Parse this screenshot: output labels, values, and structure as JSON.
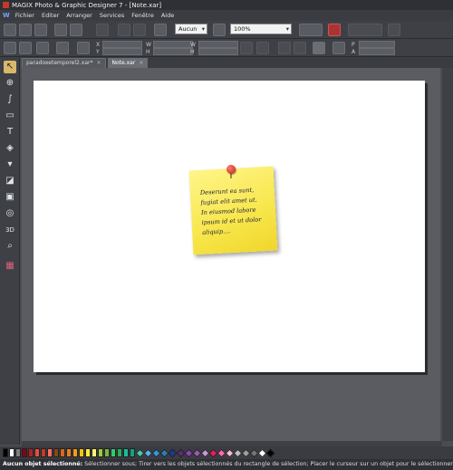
{
  "window": {
    "title": "MAGIX Photo & Graphic Designer 7 - [Note.xar]"
  },
  "menu": {
    "items": [
      "Fichier",
      "Editer",
      "Arranger",
      "Services",
      "Fenêtre",
      "Aide"
    ]
  },
  "toolbar": {
    "zoom_mode": "Aucun",
    "zoom_percent": "100%",
    "x_label": "X",
    "y_label": "Y",
    "w_label": "W",
    "h_label": "H",
    "p_label": "P",
    "a_label": "A"
  },
  "tabs": [
    {
      "label": "paradoxetemporel2.xar*",
      "active": false
    },
    {
      "label": "Note.xar",
      "active": true
    }
  ],
  "note": {
    "lines": [
      "Deserunt ea sunt,",
      "fugiat elit amet ut.",
      "In eiusmod labore",
      "ipsum id et ut dolor",
      "aliquip...."
    ]
  },
  "tools": [
    "selector-tool",
    "zoom-tool",
    "freehand-tool",
    "rectangle-tool",
    "text-tool",
    "fill-tool",
    "transparency-tool",
    "shadow-tool",
    "bevel-tool",
    "contour-tool",
    "3d-tool",
    "magnifier-tool",
    "photo-tool"
  ],
  "palette": {
    "colors": [
      "#000000",
      "#ffffff",
      "#7f7f7f",
      "#880015",
      "#b22222",
      "#e74c3c",
      "#c0392b",
      "#ff6f61",
      "#8b4513",
      "#d2691e",
      "#e67e22",
      "#f39c12",
      "#f1c40f",
      "#ffeb3b",
      "#fff176",
      "#9acd32",
      "#7cb342",
      "#2ecc71",
      "#27ae60",
      "#1abc9c",
      "#16a085",
      "#48c9b0",
      "#5dade2",
      "#3498db",
      "#2980b9",
      "#1f3a93",
      "#5b2c6f",
      "#8e44ad",
      "#9b59b6",
      "#c39bd3",
      "#e91e63",
      "#ff69b4",
      "#f8bbd0",
      "#bdbdbd",
      "#9e9e9e",
      "#757575",
      "#ffffff",
      "#000000"
    ]
  },
  "status": {
    "bold": "Aucun objet sélectionné:",
    "text": " Sélectionner sous; Tirer vers les objets sélectionnés du rectangle de sélection; Placer le curseur sur un objet pour le sélectionner"
  }
}
